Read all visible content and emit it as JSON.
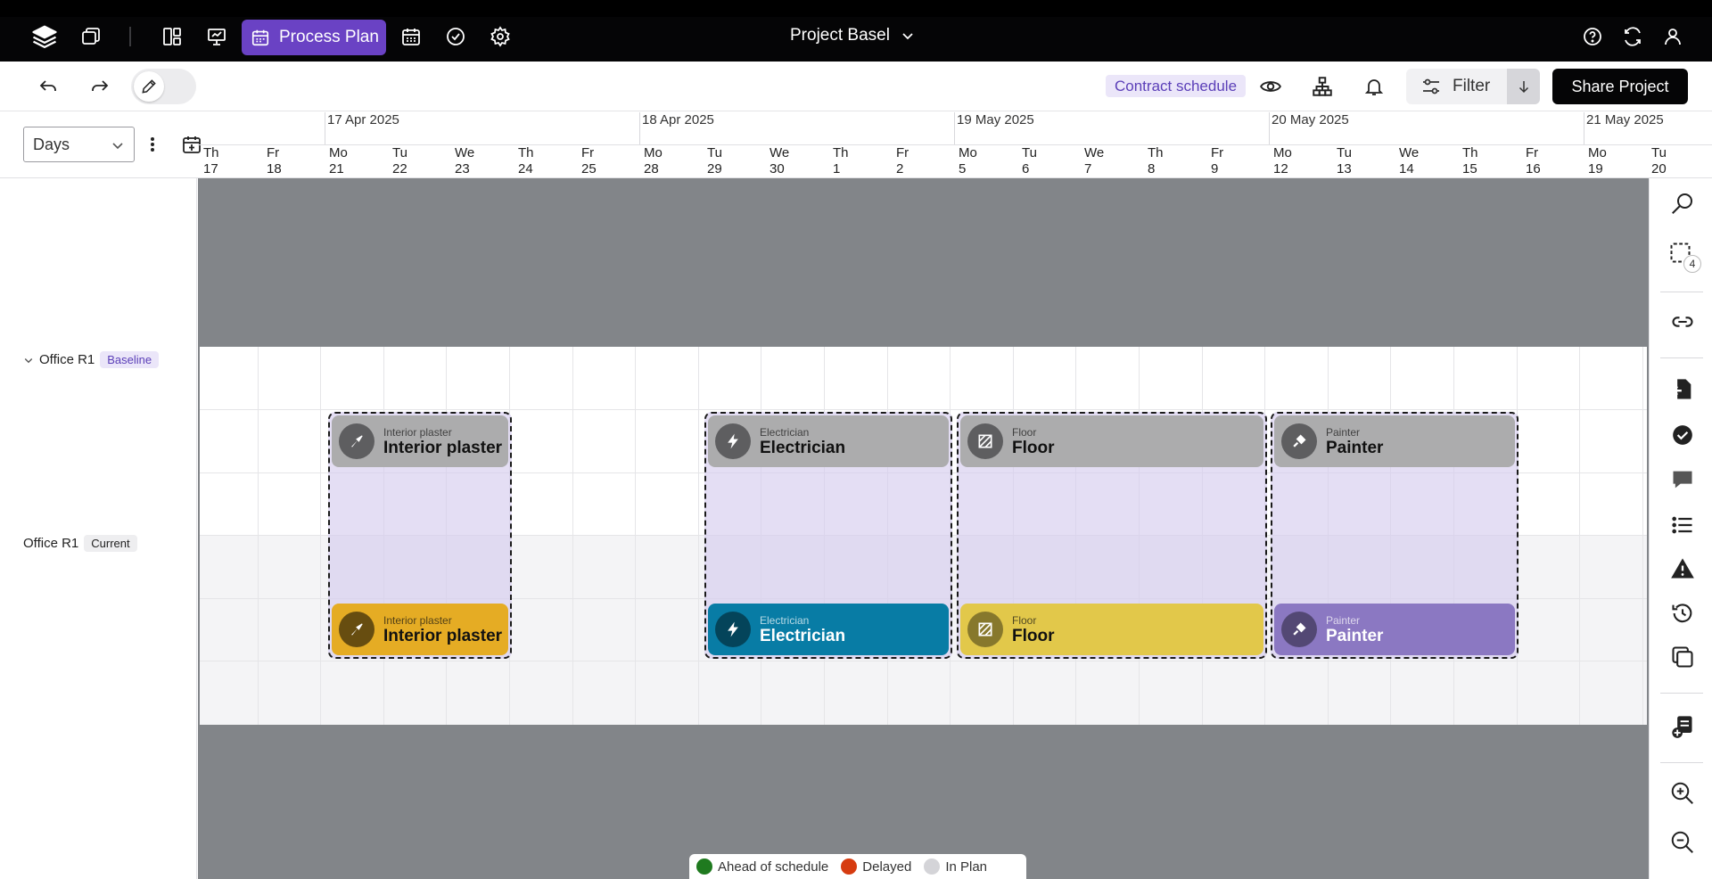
{
  "topbar": {
    "process_plan_label": "Process Plan",
    "project_title": "Project Basel"
  },
  "toolbar": {
    "contract_schedule": "Contract schedule",
    "filter_label": "Filter",
    "share_label": "Share Project"
  },
  "timeline": {
    "scale_select": "Days",
    "dates": [
      {
        "label": "17 Apr 2025"
      },
      {
        "label": "18 Apr 2025"
      },
      {
        "label": "19 May 2025"
      },
      {
        "label": "20 May 2025"
      },
      {
        "label": "21 May 2025"
      }
    ],
    "days": [
      {
        "wd": "Th",
        "d": "17"
      },
      {
        "wd": "Fr",
        "d": "18"
      },
      {
        "wd": "Mo",
        "d": "21"
      },
      {
        "wd": "Tu",
        "d": "22"
      },
      {
        "wd": "We",
        "d": "23"
      },
      {
        "wd": "Th",
        "d": "24"
      },
      {
        "wd": "Fr",
        "d": "25"
      },
      {
        "wd": "Mo",
        "d": "28"
      },
      {
        "wd": "Tu",
        "d": "29"
      },
      {
        "wd": "We",
        "d": "30"
      },
      {
        "wd": "Th",
        "d": "1"
      },
      {
        "wd": "Fr",
        "d": "2"
      },
      {
        "wd": "Mo",
        "d": "5"
      },
      {
        "wd": "Tu",
        "d": "6"
      },
      {
        "wd": "We",
        "d": "7"
      },
      {
        "wd": "Th",
        "d": "8"
      },
      {
        "wd": "Fr",
        "d": "9"
      },
      {
        "wd": "Mo",
        "d": "12"
      },
      {
        "wd": "Tu",
        "d": "13"
      },
      {
        "wd": "We",
        "d": "14"
      },
      {
        "wd": "Th",
        "d": "15"
      },
      {
        "wd": "Fr",
        "d": "16"
      },
      {
        "wd": "Mo",
        "d": "19"
      },
      {
        "wd": "Tu",
        "d": "20"
      }
    ]
  },
  "rows": {
    "baseline": {
      "name": "Office R1",
      "badge": "Baseline"
    },
    "current": {
      "name": "Office R1",
      "badge": "Current"
    }
  },
  "tasks": {
    "baseline": [
      {
        "trade": "Interior plaster",
        "name": "Interior plaster",
        "icon": "trowel-icon"
      },
      {
        "trade": "Electrician",
        "name": "Electrician",
        "icon": "lightning-icon"
      },
      {
        "trade": "Floor",
        "name": "Floor",
        "icon": "floor-tiles-icon"
      },
      {
        "trade": "Painter",
        "name": "Painter",
        "icon": "paint-roller-icon"
      }
    ],
    "current": [
      {
        "trade": "Interior plaster",
        "name": "Interior plaster",
        "icon": "trowel-icon",
        "color": "#e5ac24"
      },
      {
        "trade": "Electrician",
        "name": "Electrician",
        "icon": "lightning-icon",
        "color": "#087ca5"
      },
      {
        "trade": "Floor",
        "name": "Floor",
        "icon": "floor-tiles-icon",
        "color": "#e2c84a"
      },
      {
        "trade": "Painter",
        "name": "Painter",
        "icon": "paint-roller-icon",
        "color": "#8b78c2"
      }
    ]
  },
  "sidebar": {
    "selection_count": "4"
  },
  "legend": {
    "items": [
      {
        "label": "Ahead of schedule",
        "color": "#1f7a1f"
      },
      {
        "label": "Delayed",
        "color": "#d63b10"
      },
      {
        "label": "In Plan",
        "color": "#d4d4d8"
      }
    ]
  }
}
